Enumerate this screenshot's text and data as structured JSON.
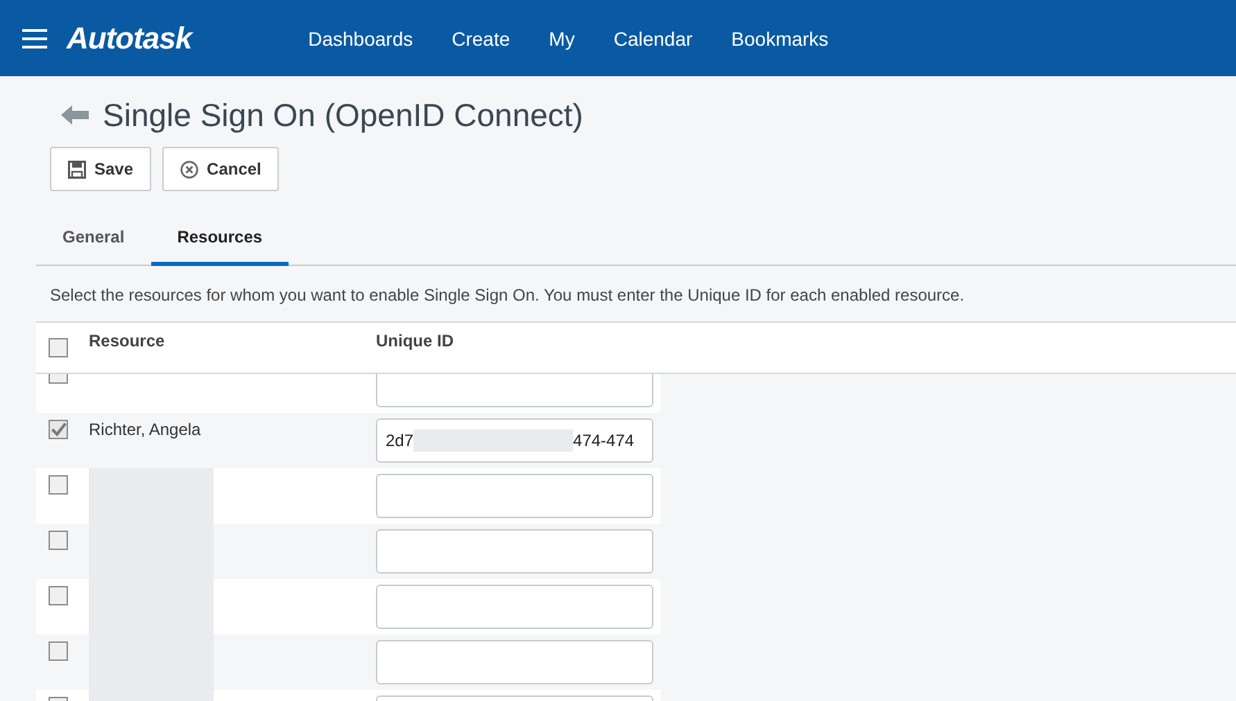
{
  "nav": {
    "brand": "Autotask",
    "items": [
      "Dashboards",
      "Create",
      "My",
      "Calendar",
      "Bookmarks"
    ]
  },
  "page": {
    "title": "Single Sign On (OpenID Connect)"
  },
  "buttons": [
    {
      "label": "Save",
      "kind": "save"
    },
    {
      "label": "Cancel",
      "kind": "cancel"
    }
  ],
  "tabs": [
    {
      "label": "General",
      "selected": false
    },
    {
      "label": "Resources",
      "selected": true
    }
  ],
  "description": "Select the resources for whom you want to enable Single Sign On. You must enter the Unique ID for each enabled resource.",
  "table": {
    "columns": [
      "Resource",
      "Unique ID"
    ],
    "select_all_checked": false,
    "rows": [
      {
        "checked": false
      },
      {
        "name": "Richter, Angela",
        "checked": true,
        "unique_id_start": "2d7",
        "unique_id_redacted": true,
        "unique_id_end": "474-474"
      },
      {
        "name_redacted": true,
        "checked": false
      },
      {
        "name_redacted": true,
        "checked": false
      },
      {
        "name_redacted": true,
        "checked": false
      },
      {
        "name_redacted": true,
        "checked": false
      },
      {
        "name_redacted": true,
        "checked": false
      }
    ]
  }
}
